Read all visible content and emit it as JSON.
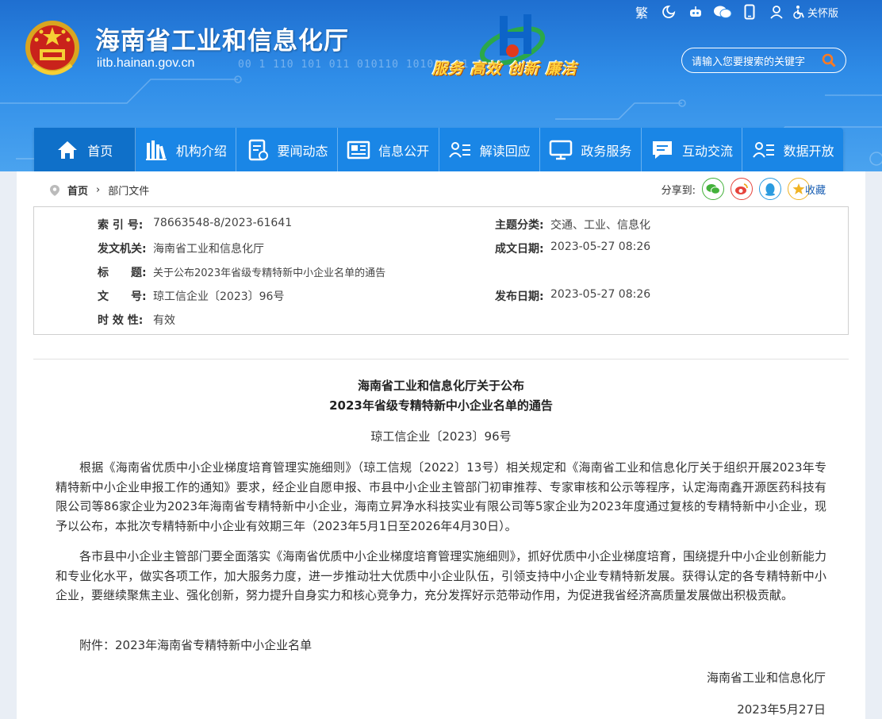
{
  "header": {
    "site_title": "海南省工业和信息化厅",
    "site_domain": "iitb.hainan.gov.cn",
    "slogan": "服务 高效 创新 廉洁",
    "binary_decoration": "00 1 110 101 011 010110 101010 01 1010",
    "tools": {
      "traditional": "繁",
      "care_mode": "关怀版"
    },
    "search_placeholder": "请输入您要搜索的关键字"
  },
  "nav": {
    "items": [
      {
        "label": "首页",
        "icon": "home-icon"
      },
      {
        "label": "机构介绍",
        "icon": "books-icon"
      },
      {
        "label": "要闻动态",
        "icon": "news-icon"
      },
      {
        "label": "信息公开",
        "icon": "newspaper-icon"
      },
      {
        "label": "解读回应",
        "icon": "people-list-icon"
      },
      {
        "label": "政务服务",
        "icon": "monitor-icon"
      },
      {
        "label": "互动交流",
        "icon": "chat-icon"
      },
      {
        "label": "数据开放",
        "icon": "data-list-icon"
      }
    ]
  },
  "breadcrumb": {
    "home": "首页",
    "separator": "›",
    "current": "部门文件"
  },
  "share": {
    "label": "分享到:",
    "favorite": "收藏"
  },
  "meta": {
    "index_label": "索 引 号:",
    "index_value": "78663548-8/2023-61641",
    "category_label": "主题分类:",
    "category_value": "交通、工业、信息化",
    "issuer_label": "发文机关:",
    "issuer_value": "海南省工业和信息化厅",
    "created_label": "成文日期:",
    "created_value": "2023-05-27 08:26",
    "title_label": "标　　题:",
    "title_value": "关于公布2023年省级专精特新中小企业名单的通告",
    "docno_label": "文　　号:",
    "docno_value": "琼工信企业〔2023〕96号",
    "published_label": "发布日期:",
    "published_value": "2023-05-27 08:26",
    "validity_label": "时 效 性:",
    "validity_value": "有效"
  },
  "article": {
    "title_line1": "海南省工业和信息化厅关于公布",
    "title_line2": "2023年省级专精特新中小企业名单的通告",
    "doc_number": "琼工信企业〔2023〕96号",
    "paragraph1": "根据《海南省优质中小企业梯度培育管理实施细则》（琼工信规〔2022〕13号）相关规定和《海南省工业和信息化厅关于组织开展2023年专精特新中小企业申报工作的通知》要求，经企业自愿申报、市县中小企业主管部门初审推荐、专家审核和公示等程序，认定海南鑫开源医药科技有限公司等86家企业为2023年海南省专精特新中小企业，海南立昇净水科技实业有限公司等5家企业为2023年度通过复核的专精特新中小企业，现予以公布，本批次专精特新中小企业有效期三年（2023年5月1日至2026年4月30日）。",
    "paragraph2": "各市县中小企业主管部门要全面落实《海南省优质中小企业梯度培育管理实施细则》，抓好优质中小企业梯度培育，围绕提升中小企业创新能力和专业化水平，做实各项工作，加大服务力度，进一步推动壮大优质中小企业队伍，引领支持中小企业专精特新发展。获得认定的各专精特新中小企业，要继续聚焦主业、强化创新，努力提升自身实力和核心竞争力，充分发挥好示范带动作用，为促进我省经济高质量发展做出积极贡献。",
    "attachment": "附件：2023年海南省专精特新中小企业名单",
    "signature": "海南省工业和信息化厅",
    "date": "2023年5月27日"
  },
  "colors": {
    "header_blue": "#2f8de8",
    "nav_blue": "#1a86e6",
    "slogan_yellow": "#ffd13a",
    "wechat_green": "#43b13a",
    "weibo_red": "#e6433c",
    "qq_blue": "#2a9be0",
    "fav_gold": "#f1b323"
  }
}
